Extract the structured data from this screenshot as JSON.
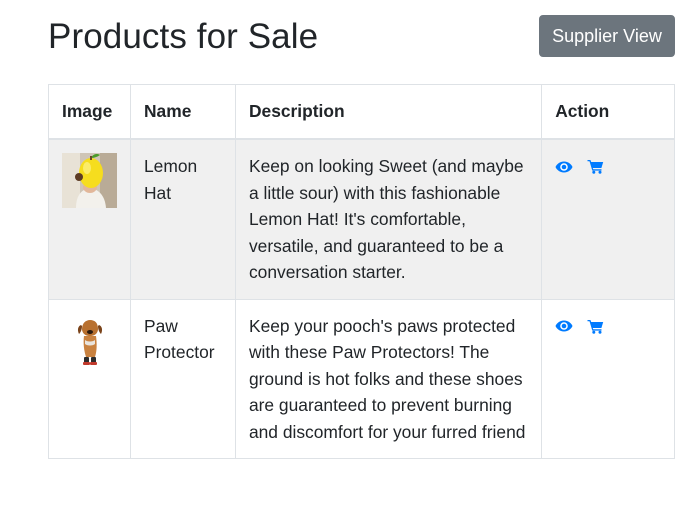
{
  "page": {
    "title": "Products for Sale",
    "supplier_button": "Supplier View"
  },
  "table": {
    "headers": {
      "image": "Image",
      "name": "Name",
      "description": "Description",
      "action": "Action"
    },
    "rows": [
      {
        "image_icon": "lemon-hat-photo",
        "name": "Lemon Hat",
        "description": "Keep on looking Sweet (and maybe a little sour) with this fashionable Lemon Hat! It's comfortable, versatile, and guaranteed to be a conversation starter."
      },
      {
        "image_icon": "paw-protector-photo",
        "name": "Paw Protector",
        "description": "Keep your pooch's paws protected with these Paw Protectors! The ground is hot folks and these shoes are guaranteed to prevent burning and discomfort for your furred friend"
      }
    ],
    "action_icons": [
      "eye-icon",
      "shopping-cart-icon"
    ]
  },
  "colors": {
    "accent": "#007bff",
    "secondary_button": "#6c757d",
    "stripe": "#f0f0f0",
    "border": "#dee2e6",
    "text": "#212529"
  }
}
